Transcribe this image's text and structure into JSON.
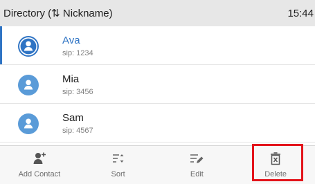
{
  "header": {
    "title": "Directory (⇅ Nickname)",
    "time": "15:44"
  },
  "contacts": [
    {
      "name": "Ava",
      "sip": "sip: 1234",
      "selected": true
    },
    {
      "name": "Mia",
      "sip": "sip: 3456",
      "selected": false
    },
    {
      "name": "Sam",
      "sip": "sip: 4567",
      "selected": false
    }
  ],
  "softkeys": {
    "add_contact": "Add Contact",
    "sort": "Sort",
    "edit": "Edit",
    "delete": "Delete"
  },
  "colors": {
    "accent": "#2f74c4",
    "avatar": "#5a9bd8",
    "highlight": "#e3141b"
  },
  "icons": {
    "avatar": "person-avatar-icon",
    "add_contact": "add-contact-icon",
    "sort": "sort-icon",
    "edit": "edit-icon",
    "delete": "trash-delete-icon"
  }
}
